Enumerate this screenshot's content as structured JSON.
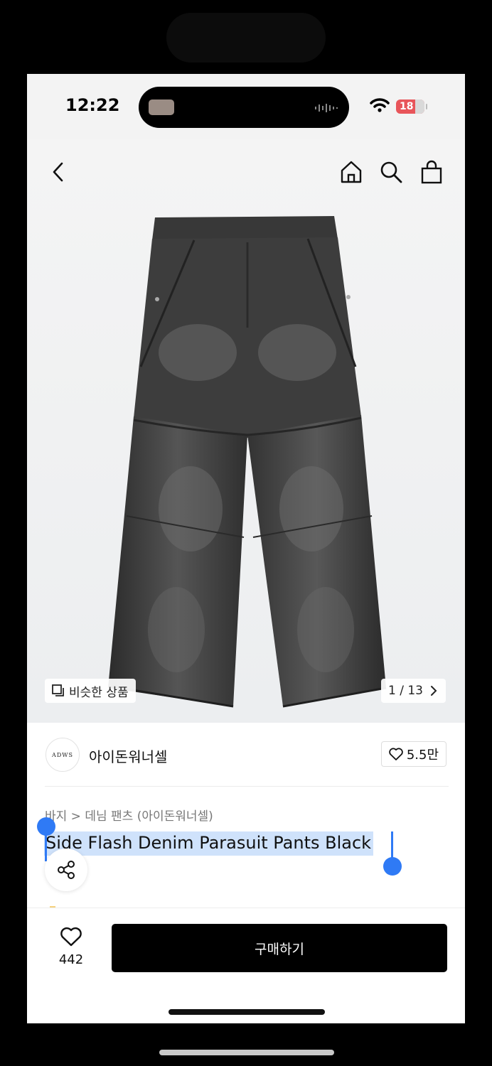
{
  "status_bar": {
    "time": "12:22",
    "battery": "18"
  },
  "header": {
    "back_icon": "chevron-left-icon",
    "home_icon": "home-icon",
    "search_icon": "search-icon",
    "bag_icon": "shopping-bag-icon"
  },
  "gallery": {
    "similar_label": "비슷한 상품",
    "pager": "1 / 13",
    "pager_icon": "chevron-right-icon"
  },
  "brand": {
    "logo_text": "ADWS",
    "name": "아이돈워너셀",
    "likes": "5.5만"
  },
  "product": {
    "breadcrumb": "바지 > 데님 팬츠 (아이돈워너셀)",
    "title": "Side Flash Denim Parasuit Pants Black"
  },
  "footer": {
    "wish_count": "442",
    "buy_label": "구매하기"
  },
  "colors": {
    "accent": "#2f7af5",
    "selection": "#cfe2fb",
    "buy_button": "#000000"
  }
}
